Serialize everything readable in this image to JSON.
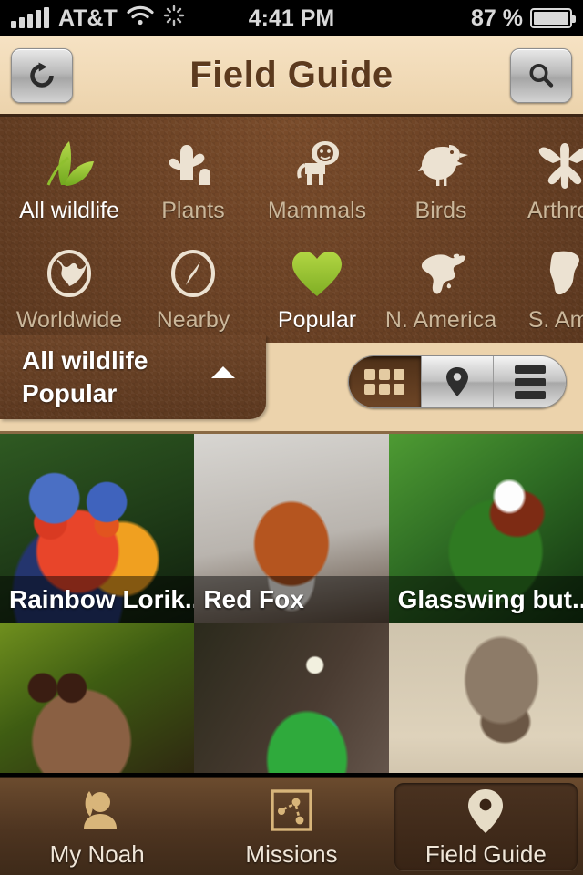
{
  "status_bar": {
    "carrier": "AT&T",
    "time": "4:41 PM",
    "battery_percent": "87 %",
    "signal_icon": "signal-bars-icon",
    "wifi_icon": "wifi-icon",
    "activity_icon": "activity-spinner-icon",
    "battery_icon": "battery-icon"
  },
  "nav": {
    "title": "Field Guide",
    "refresh_icon": "refresh-icon",
    "search_icon": "search-icon"
  },
  "categories": {
    "row1": [
      {
        "label": "All wildlife",
        "icon": "leaves-icon",
        "selected": true
      },
      {
        "label": "Plants",
        "icon": "cactus-icon",
        "selected": false
      },
      {
        "label": "Mammals",
        "icon": "lion-icon",
        "selected": false
      },
      {
        "label": "Birds",
        "icon": "bird-icon",
        "selected": false
      },
      {
        "label": "Arthrop",
        "icon": "dragonfly-icon",
        "selected": false
      }
    ],
    "row2": [
      {
        "label": "Worldwide",
        "icon": "globe-icon",
        "selected": false
      },
      {
        "label": "Nearby",
        "icon": "compass-icon",
        "selected": false
      },
      {
        "label": "Popular",
        "icon": "heart-icon",
        "selected": true
      },
      {
        "label": "N. America",
        "icon": "north-america-icon",
        "selected": false
      },
      {
        "label": "S. Ame",
        "icon": "south-america-icon",
        "selected": false
      }
    ]
  },
  "filter_summary": {
    "line1": "All wildlife",
    "line2": "Popular",
    "collapse_icon": "chevron-up-icon"
  },
  "view_switcher": {
    "options": [
      {
        "name": "grid",
        "icon": "grid-icon",
        "selected": true
      },
      {
        "name": "map",
        "icon": "map-pin-icon",
        "selected": false
      },
      {
        "name": "list",
        "icon": "list-icon",
        "selected": false
      }
    ]
  },
  "photo_grid": {
    "items": [
      {
        "caption": "Rainbow Lorik...",
        "art": "ph-lorikeet",
        "has_caption": true
      },
      {
        "caption": "Red Fox",
        "art": "ph-fox",
        "has_caption": true
      },
      {
        "caption": "Glasswing but...",
        "art": "ph-butterfly",
        "has_caption": true
      },
      {
        "caption": "",
        "art": "ph-spider",
        "has_caption": false
      },
      {
        "caption": "",
        "art": "ph-lanternfly",
        "has_caption": false
      },
      {
        "caption": "",
        "art": "ph-antelope",
        "has_caption": false
      }
    ]
  },
  "tab_bar": {
    "tabs": [
      {
        "label": "My Noah",
        "icon": "person-leaf-icon",
        "selected": false
      },
      {
        "label": "Missions",
        "icon": "missions-icon",
        "selected": false
      },
      {
        "label": "Field Guide",
        "icon": "map-pin-icon",
        "selected": true
      }
    ]
  },
  "colors": {
    "accent_green": "#9fc633",
    "panel_brown": "#6b4226",
    "navbar_tan": "#ecd3ac",
    "tabbar_brown": "#4d3420"
  }
}
